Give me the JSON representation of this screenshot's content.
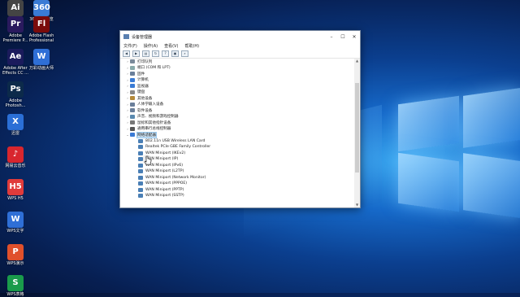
{
  "desktop": {
    "icons": [
      {
        "label": "Adobe\nCreat...",
        "glyph": "Ai",
        "color": "#444"
      },
      {
        "label": "360极速浏览器",
        "glyph": "360",
        "color": "#3a7bd5"
      },
      {
        "label": "Adobe\nPremiere P...",
        "glyph": "Pr",
        "color": "#2a1a5e"
      },
      {
        "label": "Adobe Flash\nProfessional",
        "glyph": "Fl",
        "color": "#7a0b0b"
      },
      {
        "label": "Adobe After\nEffects CC ...",
        "glyph": "Ae",
        "color": "#1b1b5c"
      },
      {
        "label": "万彩动画大师",
        "glyph": "W",
        "color": "#2f6fd6"
      },
      {
        "label": "Adobe\nPhotosh...",
        "glyph": "Ps",
        "color": "#0c2a4a"
      },
      {
        "label": "迅雷",
        "glyph": "X",
        "color": "#2b6fd6"
      },
      {
        "label": "网易云音乐",
        "glyph": "♪",
        "color": "#d8262e"
      },
      {
        "label": "WPS H5",
        "glyph": "H5",
        "color": "#e03b3b"
      },
      {
        "label": "WPS文字",
        "glyph": "W",
        "color": "#2f6fd6"
      },
      {
        "label": "WPS演示",
        "glyph": "P",
        "color": "#e0502b"
      },
      {
        "label": "WPS表格",
        "glyph": "S",
        "color": "#1a9b4b"
      }
    ]
  },
  "window": {
    "title": "设备管理器",
    "menu": [
      "文件(F)",
      "操作(A)",
      "查看(V)",
      "帮助(H)"
    ],
    "toolbar_icons": [
      "back-icon",
      "forward-icon",
      "properties-icon",
      "refresh-icon",
      "help-icon",
      "device-icon",
      "scan-icon"
    ],
    "tree": [
      {
        "label": "打印队列",
        "level": 0,
        "expand": "›",
        "color": "#7a8a9a"
      },
      {
        "label": "端口 (COM 和 LPT)",
        "level": 0,
        "expand": "›",
        "color": "#8aa"
      },
      {
        "label": "固件",
        "level": 0,
        "expand": "›",
        "color": "#6a7f9a"
      },
      {
        "label": "计算机",
        "level": 0,
        "expand": "›",
        "color": "#3a7bd5"
      },
      {
        "label": "监视器",
        "level": 0,
        "expand": "›",
        "color": "#3a7bd5"
      },
      {
        "label": "键盘",
        "level": 0,
        "expand": "›",
        "color": "#888"
      },
      {
        "label": "其他设备",
        "level": 0,
        "expand": "›",
        "color": "#b58a3a"
      },
      {
        "label": "人体学输入设备",
        "level": 0,
        "expand": "›",
        "color": "#6a7f9a"
      },
      {
        "label": "软件设备",
        "level": 0,
        "expand": "›",
        "color": "#6a7f9a"
      },
      {
        "label": "声音、视频和游戏控制器",
        "level": 0,
        "expand": "›",
        "color": "#5a8ab0"
      },
      {
        "label": "鼠标和其他指针设备",
        "level": 0,
        "expand": "›",
        "color": "#777"
      },
      {
        "label": "通用串行总线控制器",
        "level": 0,
        "expand": "›",
        "color": "#555"
      },
      {
        "label": "网络适配器",
        "level": 0,
        "expand": "⌄",
        "color": "#3a7bd5",
        "selected": true
      },
      {
        "label": "802.11n USB Wireless LAN Card",
        "level": 1,
        "color": "#4a7fb5"
      },
      {
        "label": "Realtek PCIe GBE Family Controller",
        "level": 1,
        "color": "#4a7fb5"
      },
      {
        "label": "WAN Miniport (IKEv2)",
        "level": 1,
        "color": "#4a7fb5"
      },
      {
        "label": "WAN Miniport (IP)",
        "level": 1,
        "color": "#4a7fb5"
      },
      {
        "label": "WAN Miniport (IPv6)",
        "level": 1,
        "color": "#4a7fb5"
      },
      {
        "label": "WAN Miniport (L2TP)",
        "level": 1,
        "color": "#4a7fb5"
      },
      {
        "label": "WAN Miniport (Network Monitor)",
        "level": 1,
        "color": "#4a7fb5"
      },
      {
        "label": "WAN Miniport (PPPOE)",
        "level": 1,
        "color": "#4a7fb5"
      },
      {
        "label": "WAN Miniport (PPTP)",
        "level": 1,
        "color": "#4a7fb5"
      },
      {
        "label": "WAN Miniport (SSTP)",
        "level": 1,
        "color": "#4a7fb5"
      }
    ]
  }
}
